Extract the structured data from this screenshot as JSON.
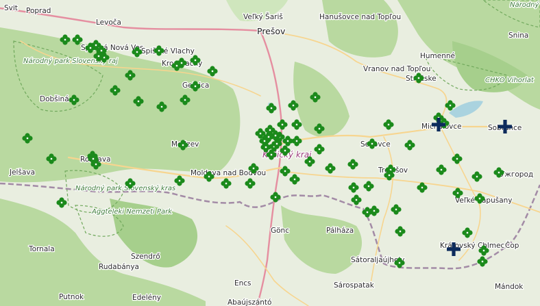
{
  "map": {
    "colors": {
      "land": "#e9eee0",
      "forest": "#b9d9a0",
      "forest_dark": "#a6cf8c",
      "park": "#cfe6bd",
      "water": "#aad3df",
      "major_road": "#e58ea0",
      "road": "#f7d58f",
      "border": "#9b7fa0",
      "marker": "#1b8a1b",
      "marker_selected": "#0d2b5c"
    },
    "places": [
      {
        "name": "Svit"
      },
      {
        "name": "Poprad"
      },
      {
        "name": "Levoča"
      },
      {
        "name": "Veľký Šariš"
      },
      {
        "name": "Prešov"
      },
      {
        "name": "Hanušovce nad Topľou"
      },
      {
        "name": "Snina"
      },
      {
        "name": "Humenné"
      },
      {
        "name": "Vranov nad Topľou"
      },
      {
        "name": "Strážske"
      },
      {
        "name": "Michalovce"
      },
      {
        "name": "Sobrance"
      },
      {
        "name": "Košický kraj"
      },
      {
        "name": "Moldava nad Bodvou"
      },
      {
        "name": "Rožňava"
      },
      {
        "name": "Jelšava"
      },
      {
        "name": "Dobšiná"
      },
      {
        "name": "Gelnica"
      },
      {
        "name": "Krompachy"
      },
      {
        "name": "Spišská Nová Ves"
      },
      {
        "name": "Spišské Vlachy"
      },
      {
        "name": "Medzev"
      },
      {
        "name": "Sečovce"
      },
      {
        "name": "Trebišov"
      },
      {
        "name": "Veľké Kapušany"
      },
      {
        "name": "Kráľovský Chlmec"
      },
      {
        "name": "Ужгород"
      },
      {
        "name": "Čop"
      },
      {
        "name": "Gönc"
      },
      {
        "name": "Pálháza"
      },
      {
        "name": "Sátoraljaújhely"
      },
      {
        "name": "Sárospatak"
      },
      {
        "name": "Encs"
      },
      {
        "name": "Abaújszántó"
      },
      {
        "name": "Szendrő"
      },
      {
        "name": "Rudabánya"
      },
      {
        "name": "Tornala"
      },
      {
        "name": "Putnok"
      },
      {
        "name": "Edelény"
      },
      {
        "name": "Mándok"
      }
    ],
    "parks": [
      {
        "name": "Národný park Slovenský raj"
      },
      {
        "name": "Národný park Slovenský kras"
      },
      {
        "name": "Aggteleki Nemzeti Park"
      },
      {
        "name": "CHKO Vihorlat"
      },
      {
        "name": "Národný park Poloniny"
      }
    ],
    "markers_count": 104,
    "selected_markers": 3
  }
}
